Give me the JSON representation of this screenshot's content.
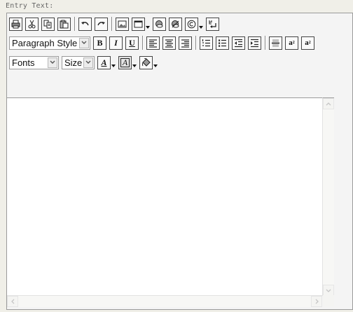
{
  "field": {
    "label": "Entry Text:"
  },
  "toolbar": {
    "row1": [
      {
        "name": "print-button",
        "icon": "printer-icon"
      },
      {
        "name": "cut-button",
        "icon": "scissors-icon"
      },
      {
        "name": "copy-button",
        "icon": "copy-icon"
      },
      {
        "name": "paste-button",
        "icon": "paste-icon"
      },
      {
        "name": "undo-button",
        "icon": "undo-icon"
      },
      {
        "name": "redo-button",
        "icon": "redo-icon"
      },
      {
        "name": "insert-image-button",
        "icon": "image-icon"
      },
      {
        "name": "insert-table-button",
        "icon": "table-icon"
      },
      {
        "name": "insert-link-button",
        "icon": "link-icon"
      },
      {
        "name": "remove-link-button",
        "icon": "unlink-icon"
      },
      {
        "name": "special-character-button",
        "icon": "copyright-icon"
      },
      {
        "name": "line-break-button",
        "icon": "line-break-icon"
      }
    ],
    "paragraph_style": {
      "value": "Paragraph Style"
    },
    "bold": {
      "label": "B"
    },
    "italic": {
      "label": "I"
    },
    "underline": {
      "label": "U"
    },
    "superscript": {
      "label": "a",
      "mark": "2"
    },
    "subscript": {
      "label": "a",
      "mark": "2"
    },
    "fonts": {
      "value": "Fonts"
    },
    "size": {
      "value": "Size"
    },
    "font_color": {
      "label": "A"
    },
    "highlight_color": {
      "label": "A"
    }
  },
  "colors": {
    "page_bg": "#f0efe8",
    "editor_border": "#9a9a9a",
    "button_border": "#444444"
  }
}
